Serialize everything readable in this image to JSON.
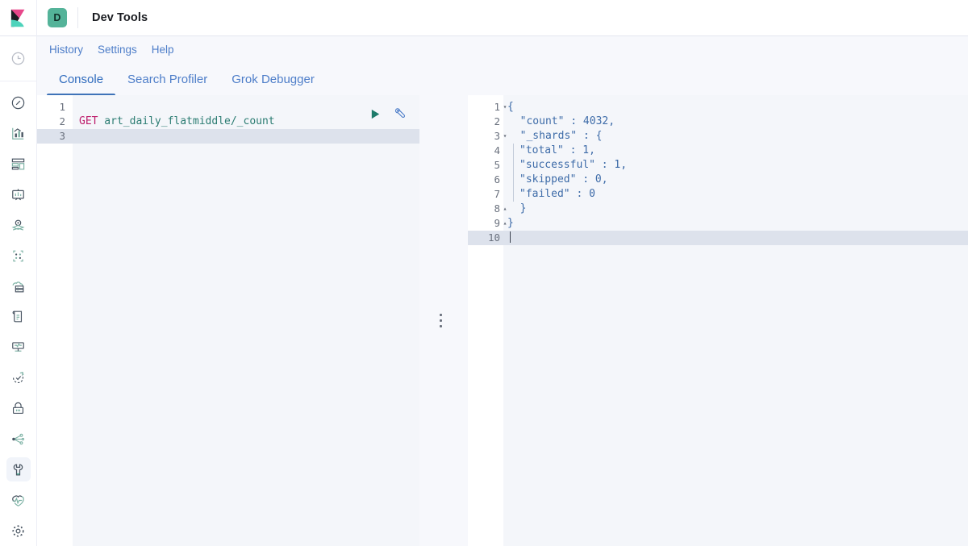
{
  "header": {
    "logo_icon": "kibana-logo",
    "app_badge_letter": "D",
    "app_title": "Dev Tools"
  },
  "sidebar": {
    "items": [
      {
        "icon": "recently-viewed-clock-icon",
        "label": "Recently viewed",
        "active": false
      },
      {
        "icon": "discover-compass-icon",
        "label": "Discover",
        "active": false
      },
      {
        "icon": "visualize-bar-chart-icon",
        "label": "Visualize",
        "active": false
      },
      {
        "icon": "dashboard-grid-icon",
        "label": "Dashboard",
        "active": false
      },
      {
        "icon": "canvas-presentation-icon",
        "label": "Canvas",
        "active": false
      },
      {
        "icon": "maps-pin-layers-icon",
        "label": "Maps",
        "active": false
      },
      {
        "icon": "machine-learning-nodes-icon",
        "label": "Machine Learning",
        "active": false
      },
      {
        "icon": "infrastructure-server-icon",
        "label": "Infrastructure",
        "active": false
      },
      {
        "icon": "logs-document-icon",
        "label": "Logs",
        "active": false
      },
      {
        "icon": "apm-monitor-icon",
        "label": "APM",
        "active": false
      },
      {
        "icon": "uptime-clock-arrow-icon",
        "label": "Uptime",
        "active": false
      },
      {
        "icon": "siem-lock-icon",
        "label": "SIEM",
        "active": false
      },
      {
        "icon": "graph-nodes-icon",
        "label": "Graph",
        "active": false
      },
      {
        "icon": "dev-tools-wrench-icon",
        "label": "Dev Tools",
        "active": true
      },
      {
        "icon": "monitoring-heartbeat-icon",
        "label": "Monitoring",
        "active": false
      },
      {
        "icon": "management-gear-icon",
        "label": "Management",
        "active": false
      }
    ]
  },
  "nav_links": [
    {
      "label": "History"
    },
    {
      "label": "Settings"
    },
    {
      "label": "Help"
    }
  ],
  "tabs": [
    {
      "label": "Console",
      "active": true
    },
    {
      "label": "Search Profiler",
      "active": false
    },
    {
      "label": "Grok Debugger",
      "active": false
    }
  ],
  "editor": {
    "actions": [
      {
        "icon": "play-send-request-icon",
        "label": "Click to send request"
      },
      {
        "icon": "wrench-open-documentation-icon",
        "label": "Open documentation"
      }
    ],
    "active_line": 3,
    "lines": [
      {
        "number": "1",
        "method": "",
        "url": "",
        "highlight": false
      },
      {
        "number": "2",
        "method": "GET",
        "url": " art_daily_flatmiddle/_count",
        "highlight": false
      },
      {
        "number": "3",
        "method": "",
        "url": "",
        "highlight": true
      }
    ]
  },
  "response": {
    "active_line": 10,
    "lines": [
      {
        "number": "1",
        "fold": "open",
        "indent": 0,
        "text": "{",
        "highlight": false,
        "caret": false
      },
      {
        "number": "2",
        "fold": "",
        "indent": 0,
        "text": "  \"count\" : 4032,",
        "highlight": false,
        "caret": false
      },
      {
        "number": "3",
        "fold": "open",
        "indent": 0,
        "text": "  \"_shards\" : {",
        "highlight": false,
        "caret": false
      },
      {
        "number": "4",
        "fold": "",
        "indent": 1,
        "text": "\"total\" : 1,",
        "highlight": false,
        "caret": false
      },
      {
        "number": "5",
        "fold": "",
        "indent": 1,
        "text": "\"successful\" : 1,",
        "highlight": false,
        "caret": false
      },
      {
        "number": "6",
        "fold": "",
        "indent": 1,
        "text": "\"skipped\" : 0,",
        "highlight": false,
        "caret": false
      },
      {
        "number": "7",
        "fold": "",
        "indent": 1,
        "text": "\"failed\" : 0",
        "highlight": false,
        "caret": false
      },
      {
        "number": "8",
        "fold": "close",
        "indent": 0,
        "text": "  }",
        "highlight": false,
        "caret": false
      },
      {
        "number": "9",
        "fold": "close",
        "indent": 0,
        "text": "}",
        "highlight": false,
        "caret": false
      },
      {
        "number": "10",
        "fold": "",
        "indent": 0,
        "text": "",
        "highlight": true,
        "caret": true
      }
    ]
  },
  "splitter": {
    "icon": "drag-handle-vertical-icon",
    "label": "Resize panels"
  },
  "colors": {
    "accent_blue": "#3f73b8",
    "link_blue": "#4e7ec9",
    "badge_teal": "#54b399",
    "method_pink": "#bd1c6b",
    "url_teal": "#2b7c72",
    "json_blue": "#3d6ba8",
    "active_line_gray": "#dde2ec",
    "page_bg": "#f7f8fc"
  }
}
